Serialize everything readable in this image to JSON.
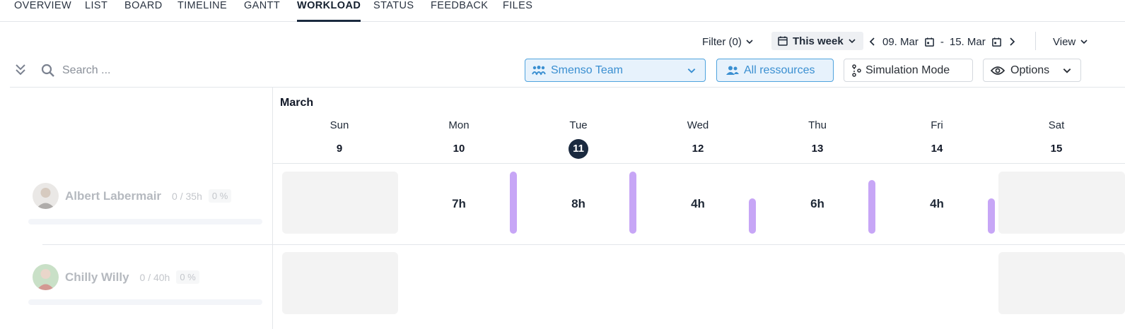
{
  "tabs": [
    {
      "label": "OVERVIEW",
      "active": false
    },
    {
      "label": "LIST",
      "active": false
    },
    {
      "label": "BOARD",
      "active": false
    },
    {
      "label": "TIMELINE",
      "active": false
    },
    {
      "label": "GANTT",
      "active": false
    },
    {
      "label": "WORKLOAD",
      "active": true
    },
    {
      "label": "STATUS",
      "active": false
    },
    {
      "label": "FEEDBACK",
      "active": false
    },
    {
      "label": "FILES",
      "active": false
    }
  ],
  "toolbar": {
    "filter_label": "Filter (0)",
    "period_label": "This week",
    "range_start": "09. Mar",
    "range_sep": "-",
    "range_end": "15. Mar",
    "view_label": "View",
    "search_placeholder": "Search ...",
    "team_label": "Smenso Team",
    "resources_label": "All ressources",
    "simulation_label": "Simulation Mode",
    "options_label": "Options"
  },
  "calendar": {
    "month": "March",
    "days": [
      {
        "name": "Sun",
        "num": "9",
        "today": false,
        "weekend": true
      },
      {
        "name": "Mon",
        "num": "10",
        "today": false,
        "weekend": false
      },
      {
        "name": "Tue",
        "num": "11",
        "today": true,
        "weekend": false
      },
      {
        "name": "Wed",
        "num": "12",
        "today": false,
        "weekend": false
      },
      {
        "name": "Thu",
        "num": "13",
        "today": false,
        "weekend": false
      },
      {
        "name": "Fri",
        "num": "14",
        "today": false,
        "weekend": false
      },
      {
        "name": "Sat",
        "num": "15",
        "today": false,
        "weekend": true
      }
    ]
  },
  "people": [
    {
      "name": "Albert Labermair",
      "hours": "0 / 35h",
      "percent": "0 %",
      "daily_hours": [
        "",
        "7h",
        "8h",
        "4h",
        "6h",
        "4h",
        ""
      ],
      "load_fraction": [
        null,
        1.0,
        1.0,
        0.57,
        0.86,
        0.57,
        null
      ]
    },
    {
      "name": "Chilly Willy",
      "hours": "0 / 40h",
      "percent": "0 %",
      "daily_hours": [
        "",
        "",
        "",
        "",
        "",
        "",
        ""
      ],
      "load_fraction": [
        null,
        null,
        null,
        null,
        null,
        null,
        null
      ]
    }
  ],
  "colors": {
    "accent": "#1b2a3f",
    "team_blue": "#3a8fd1",
    "load_bar": "#c7a6f6"
  }
}
